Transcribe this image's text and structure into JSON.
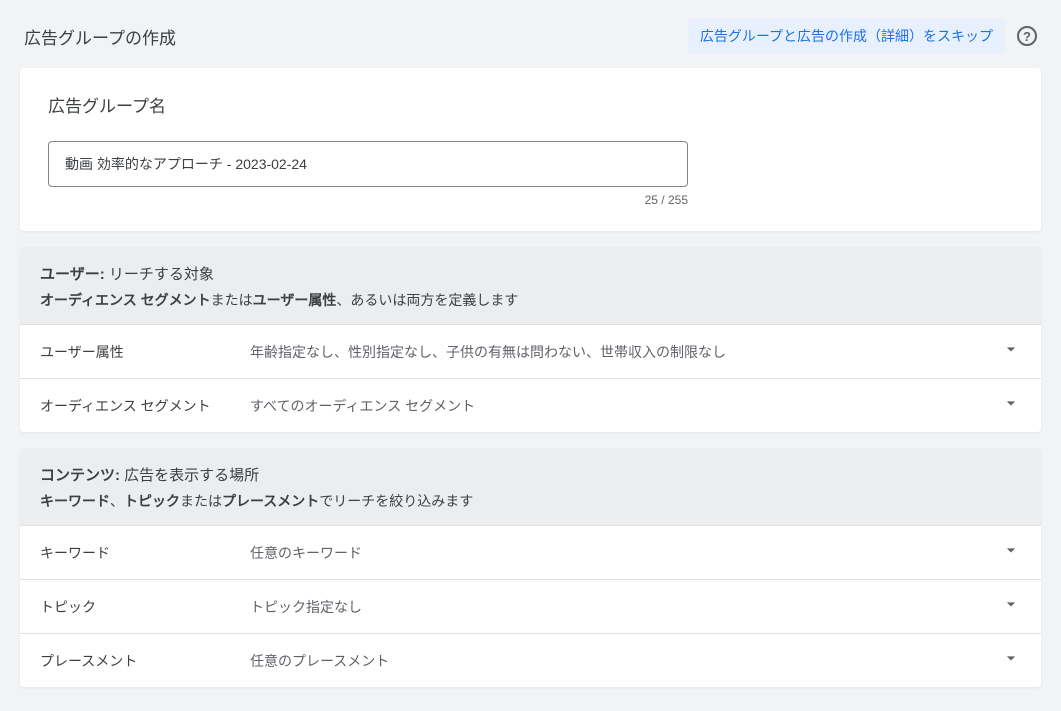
{
  "header": {
    "title": "広告グループの作成",
    "skip_label": "広告グループと広告の作成（詳細）をスキップ"
  },
  "ad_group_name": {
    "section_title": "広告グループ名",
    "input_value": "動画 効率的なアプローチ - 2023-02-24",
    "char_count": "25 / 255"
  },
  "users_section": {
    "title_bold": "ユーザー:",
    "title_rest": " リーチする対象",
    "sub_bold1": "オーディエンス セグメント",
    "sub_mid": "または",
    "sub_bold2": "ユーザー属性",
    "sub_rest": "、あるいは両方を定義します",
    "rows": [
      {
        "label": "ユーザー属性",
        "value": "年齢指定なし、性別指定なし、子供の有無は問わない、世帯収入の制限なし"
      },
      {
        "label": "オーディエンス セグメント",
        "value": "すべてのオーディエンス セグメント"
      }
    ]
  },
  "content_section": {
    "title_bold": "コンテンツ:",
    "title_rest": " 広告を表示する場所",
    "sub_bold1": "キーワード",
    "sub_mid1": "、",
    "sub_bold2": "トピック",
    "sub_mid2": "または",
    "sub_bold3": "プレースメント",
    "sub_rest": "でリーチを絞り込みます",
    "rows": [
      {
        "label": "キーワード",
        "value": "任意のキーワード"
      },
      {
        "label": "トピック",
        "value": "トピック指定なし"
      },
      {
        "label": "プレースメント",
        "value": "任意のプレースメント"
      }
    ]
  }
}
